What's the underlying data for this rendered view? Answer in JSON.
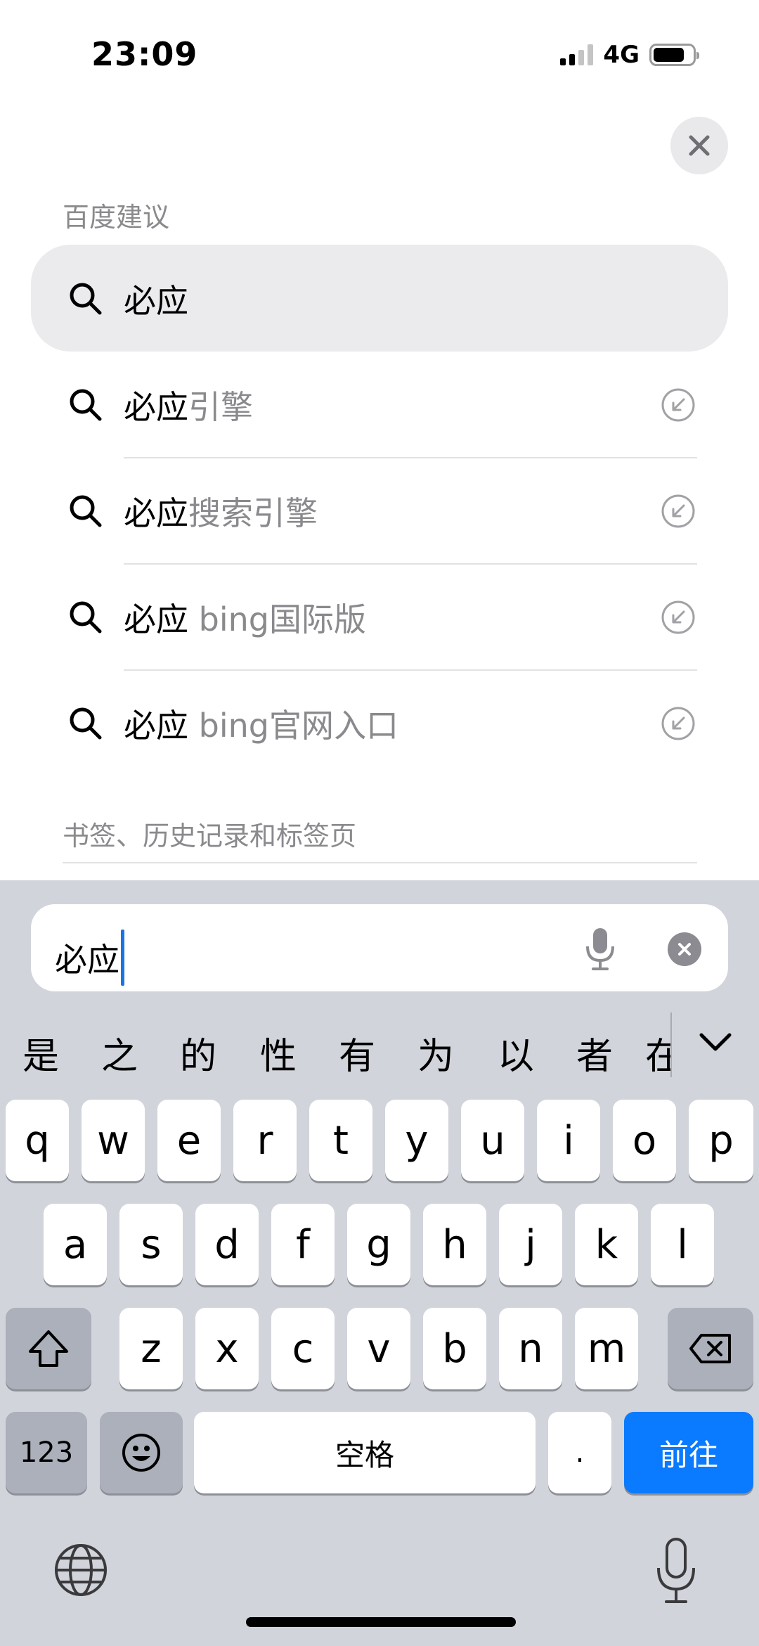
{
  "status_bar": {
    "time": "23:09",
    "network": "4G"
  },
  "sections": {
    "suggestions_title": "百度建议",
    "history_title": "书签、历史记录和标签页"
  },
  "suggestions": [
    {
      "typed": "必应",
      "rest": ""
    },
    {
      "typed": "必应",
      "rest": "引擎"
    },
    {
      "typed": "必应",
      "rest": "搜索引擎"
    },
    {
      "typed": "必应",
      "rest": " bing国际版"
    },
    {
      "typed": "必应",
      "rest": " bing官网入口"
    }
  ],
  "address_bar": {
    "value": "必应"
  },
  "candidates": [
    "是",
    "之",
    "的",
    "性",
    "有",
    "为",
    "以",
    "者",
    "在"
  ],
  "keyboard": {
    "row1": [
      "q",
      "w",
      "e",
      "r",
      "t",
      "y",
      "u",
      "i",
      "o",
      "p"
    ],
    "row2": [
      "a",
      "s",
      "d",
      "f",
      "g",
      "h",
      "j",
      "k",
      "l"
    ],
    "row3": [
      "z",
      "x",
      "c",
      "v",
      "b",
      "n",
      "m"
    ],
    "numbers_label": "123",
    "space_label": "空格",
    "period_label": ".",
    "go_label": "前往"
  },
  "icons": {
    "close": "close-icon",
    "search": "search-icon",
    "fill": "arrow-up-left-icon",
    "mic": "microphone-icon",
    "clear": "clear-icon",
    "shift": "shift-icon",
    "backspace": "backspace-icon",
    "emoji": "emoji-icon",
    "globe": "globe-icon",
    "collapse": "chevron-down-icon"
  },
  "colors": {
    "accent": "#0a7aff",
    "caret": "#1b73e8",
    "secondary_text": "#8a8a8e",
    "keyboard_bg": "#d1d4db"
  }
}
